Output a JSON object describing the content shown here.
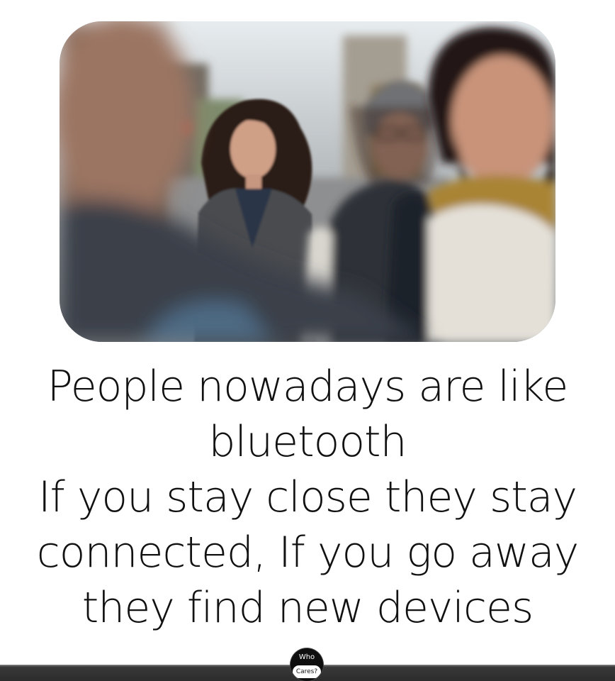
{
  "quote": {
    "lines": [
      "People nowadays are like",
      "bluetooth",
      "If you stay close they stay",
      "connected, If you go away",
      "they find new devices"
    ]
  },
  "logo": {
    "line1": "Who",
    "line2": "Cares?"
  }
}
